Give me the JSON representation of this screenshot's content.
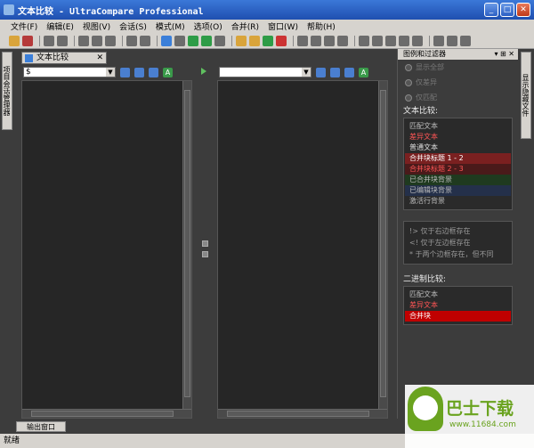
{
  "window": {
    "title": "文本比较 - UltraCompare Professional"
  },
  "menu": [
    "文件(F)",
    "编辑(E)",
    "视图(V)",
    "会话(S)",
    "模式(M)",
    "选项(O)",
    "合并(R)",
    "窗口(W)",
    "帮助(H)"
  ],
  "left_sidebar_tab": "项目会话管理器",
  "document_tab": "文本比较",
  "left_pane": {
    "path": "$"
  },
  "right_pane": {
    "path": ""
  },
  "right_sidebar_tab": "显示隐藏文件",
  "filter_panel": {
    "title": "图例和过滤器",
    "radios": [
      "显示全部",
      "仅差异",
      "仅匹配"
    ],
    "text_compare_label": "文本比较:",
    "legend": [
      {
        "label": "匹配文本",
        "fg": "#bbbbbb",
        "bg": "#2a2a2a"
      },
      {
        "label": "差异文本",
        "fg": "#ff5555",
        "bg": "#2a2a2a"
      },
      {
        "label": "普通文本",
        "fg": "#dddddd",
        "bg": "#2a2a2a"
      },
      {
        "label": "合并块标题 1 - 2",
        "fg": "#ffffff",
        "bg": "#7a2020"
      },
      {
        "label": "合并块标题 2 - 3",
        "fg": "#ff5555",
        "bg": "#4a1a1a"
      },
      {
        "label": "已合并块背景",
        "fg": "#bbbbbb",
        "bg": "#1f3a1f"
      },
      {
        "label": "已编辑块背景",
        "fg": "#bbbbbb",
        "bg": "#24304a"
      },
      {
        "label": "激活行背景",
        "fg": "#bbbbbb",
        "bg": "#2a2a2a"
      }
    ],
    "flags": [
      "!> 仅于右边框存在",
      "<! 仅于左边框存在",
      "* 于两个边框存在，但不同"
    ],
    "binary_label": "二进制比较:",
    "binary_legend": [
      {
        "label": "匹配文本",
        "fg": "#bbbbbb",
        "bg": "#2a2a2a"
      },
      {
        "label": "差异文本",
        "fg": "#ff5555",
        "bg": "#2a2a2a"
      },
      {
        "label": "合并块",
        "fg": "#ffffff",
        "bg": "#c00000"
      }
    ]
  },
  "output_tab": "输出窗口",
  "status": "就绪",
  "watermark": {
    "title": "巴士下载",
    "url": "www.11684.com"
  }
}
